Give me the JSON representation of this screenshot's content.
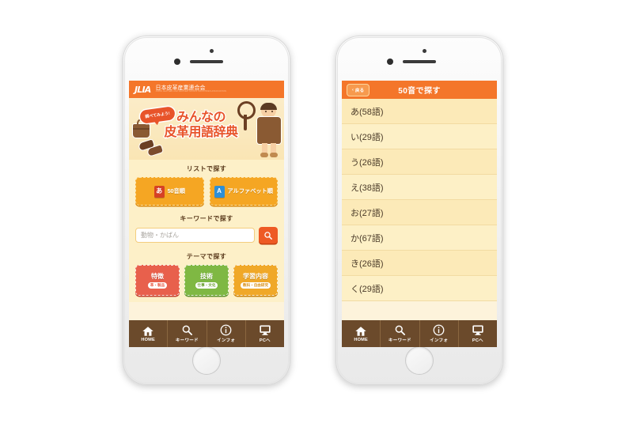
{
  "left_phone": {
    "brand_bar": {
      "logo": "JLIA",
      "org_jp": "日本皮革産業連合会",
      "org_en": "JAPAN LEATHER AND LEATHER GOODS INDUSTRIES ASSOCIATION"
    },
    "hero": {
      "bubble": "調べてみよう!",
      "title_line1": "みんなの",
      "title_line2": "皮革用語辞典"
    },
    "list_section": {
      "title": "リストで探す",
      "buttons": [
        {
          "glyph": "あ",
          "label": "50音順"
        },
        {
          "glyph": "A",
          "label": "アルファベット順"
        }
      ]
    },
    "keyword_section": {
      "title": "キーワードで探す",
      "placeholder": "動物・かばん",
      "value": "",
      "search_icon": "search-icon"
    },
    "theme_section": {
      "title": "テーマで探す",
      "buttons": [
        {
          "main": "特徴",
          "sub": "革・製品",
          "color": "#e8604c"
        },
        {
          "main": "技術",
          "sub": "仕事・文化",
          "color": "#7fb843"
        },
        {
          "main": "学習内容",
          "sub": "教科・自由研究",
          "color": "#f0a828"
        }
      ]
    },
    "navbar": [
      {
        "icon": "home-icon",
        "label": "HOME"
      },
      {
        "icon": "search-icon",
        "label": "キーワード"
      },
      {
        "icon": "info-icon",
        "label": "インフォ"
      },
      {
        "icon": "monitor-icon",
        "label": "PCへ"
      }
    ]
  },
  "right_phone": {
    "header": {
      "back_label": "戻る",
      "back_icon": "chevron-left-icon",
      "title": "50音で探す"
    },
    "kana_items": [
      "あ(58語)",
      "い(29語)",
      "う(26語)",
      "え(38語)",
      "お(27語)",
      "か(67語)",
      "き(26語)",
      "く(29語)"
    ],
    "navbar": [
      {
        "icon": "home-icon",
        "label": "HOME"
      },
      {
        "icon": "search-icon",
        "label": "キーワード"
      },
      {
        "icon": "info-icon",
        "label": "インフォ"
      },
      {
        "icon": "monitor-icon",
        "label": "PCへ"
      }
    ]
  },
  "theme_colors": {
    "orange": "#f4762a",
    "cream": "#fceab8",
    "brown": "#6b4a2b",
    "gold": "#f5a623",
    "page_bg": "#ffffff"
  }
}
